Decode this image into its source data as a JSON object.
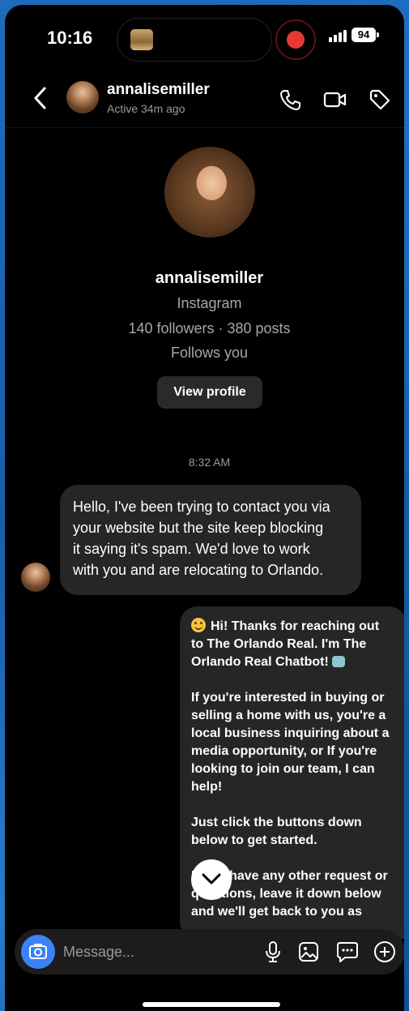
{
  "status_bar": {
    "time": "10:16",
    "battery": "94"
  },
  "header": {
    "name": "annalisemiller",
    "status": "Active 34m ago",
    "icons": [
      "back-icon",
      "phone-icon",
      "video-icon",
      "tag-icon"
    ]
  },
  "profile": {
    "name": "annalisemiller",
    "platform": "Instagram",
    "stats": "140 followers · 380 posts",
    "relation": "Follows you",
    "view_profile": "View profile"
  },
  "timestamp": "8:32 AM",
  "messages": {
    "incoming": "Hello, I've been trying to contact you via\nyour website but the site keep blocking\nit saying it's spam. We'd love to work\nwith you and are relocating to Orlando.",
    "outgoing": {
      "p1": "Hi! Thanks for reaching out\nto The Orlando Real. I'm The\nOrlando Real Chatbot!",
      "p2": "If you're interested in buying or\nselling a home with us, you're a\nlocal business inquiring about a\nmedia opportunity, or If you're\nlooking to join our team, I can\nhelp!",
      "p3": "Just click the buttons down\nbelow to get started.",
      "p4": "If you have any other request or\nquestions, leave it down below\nand we'll get back to you as"
    }
  },
  "composer": {
    "placeholder": "Message..."
  },
  "colors": {
    "accent": "#3b82f6",
    "record": "#e53935",
    "bubble": "#262626"
  }
}
